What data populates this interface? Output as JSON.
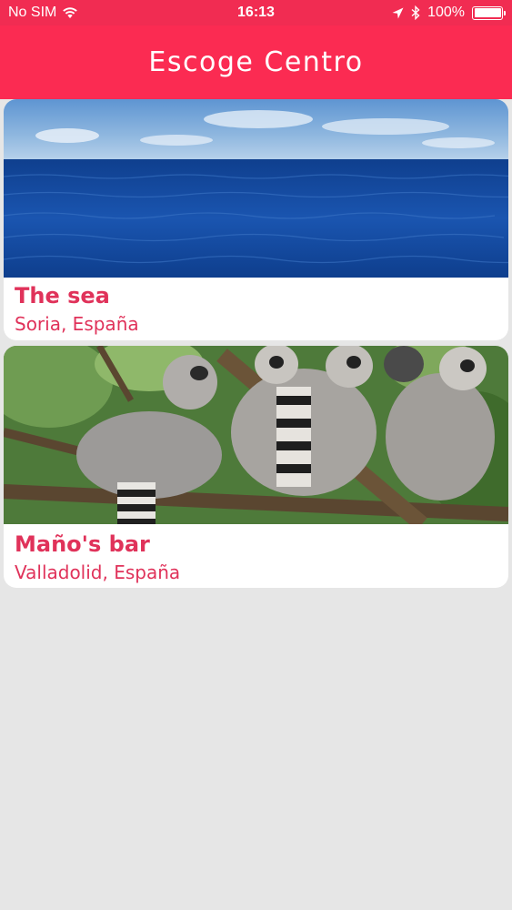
{
  "status_bar": {
    "carrier": "No SIM",
    "time": "16:13",
    "battery": "100%",
    "battery_level": 1.0
  },
  "nav": {
    "title": "Escoge Centro"
  },
  "centers": [
    {
      "name": "The sea",
      "location": "Soria, España",
      "image": "ocean-photo"
    },
    {
      "name": "Maño's bar",
      "location": "Valladolid, España",
      "image": "lemurs-photo"
    }
  ],
  "colors": {
    "accent": "#fb2b52",
    "text_accent": "#e0325a",
    "background": "#e6e6e6"
  }
}
